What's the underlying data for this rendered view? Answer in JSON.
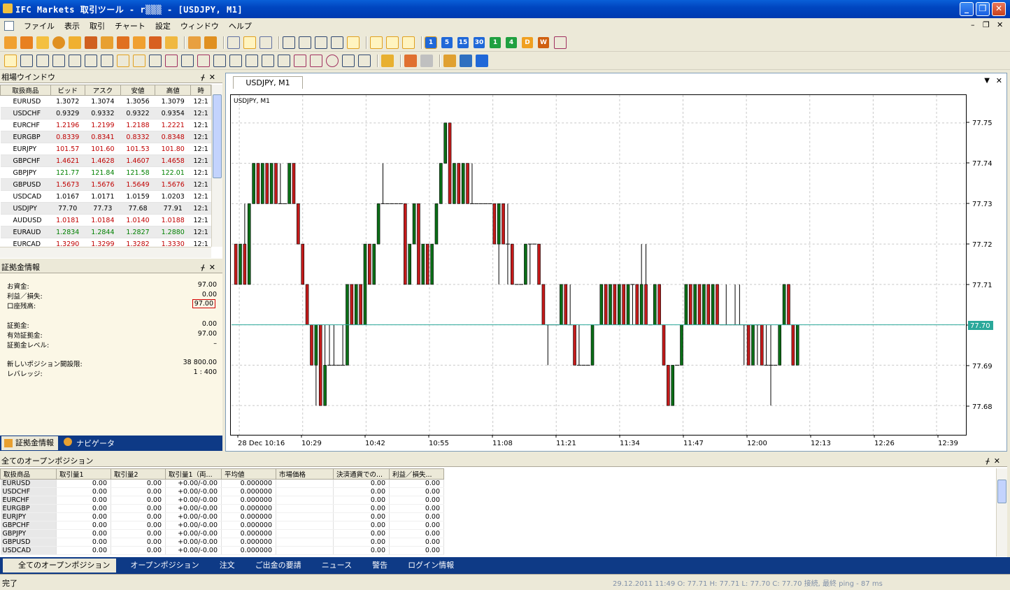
{
  "window": {
    "title": "IFC Markets 取引ツール - r▒▒▒ - [USDJPY, M1]"
  },
  "menu": [
    "ファイル",
    "表示",
    "取引",
    "チャート",
    "設定",
    "ウィンドウ",
    "ヘルプ"
  ],
  "timeframes": [
    "1",
    "5",
    "15",
    "30",
    "1",
    "4",
    "D",
    "W"
  ],
  "market_watch": {
    "title": "相場ウインドウ",
    "columns": [
      "取扱商品",
      "ビッド",
      "アスク",
      "安値",
      "高値",
      "時"
    ],
    "rows": [
      {
        "sym": "EURUSD",
        "bid": "1.3072",
        "ask": "1.3074",
        "low": "1.3056",
        "high": "1.3079",
        "time": "12:1",
        "dir": "n"
      },
      {
        "sym": "USDCHF",
        "bid": "0.9329",
        "ask": "0.9332",
        "low": "0.9322",
        "high": "0.9354",
        "time": "12:1",
        "dir": "n"
      },
      {
        "sym": "EURCHF",
        "bid": "1.2196",
        "ask": "1.2199",
        "low": "1.2188",
        "high": "1.2221",
        "time": "12:1",
        "dir": "dn"
      },
      {
        "sym": "EURGBP",
        "bid": "0.8339",
        "ask": "0.8341",
        "low": "0.8332",
        "high": "0.8348",
        "time": "12:1",
        "dir": "dn"
      },
      {
        "sym": "EURJPY",
        "bid": "101.57",
        "ask": "101.60",
        "low": "101.53",
        "high": "101.80",
        "time": "12:1",
        "dir": "dn"
      },
      {
        "sym": "GBPCHF",
        "bid": "1.4621",
        "ask": "1.4628",
        "low": "1.4607",
        "high": "1.4658",
        "time": "12:1",
        "dir": "dn"
      },
      {
        "sym": "GBPJPY",
        "bid": "121.77",
        "ask": "121.84",
        "low": "121.58",
        "high": "122.01",
        "time": "12:1",
        "dir": "up"
      },
      {
        "sym": "GBPUSD",
        "bid": "1.5673",
        "ask": "1.5676",
        "low": "1.5649",
        "high": "1.5676",
        "time": "12:1",
        "dir": "dn"
      },
      {
        "sym": "USDCAD",
        "bid": "1.0167",
        "ask": "1.0171",
        "low": "1.0159",
        "high": "1.0203",
        "time": "12:1",
        "dir": "n"
      },
      {
        "sym": "USDJPY",
        "bid": "77.70",
        "ask": "77.73",
        "low": "77.68",
        "high": "77.91",
        "time": "12:1",
        "dir": "n"
      },
      {
        "sym": "AUDUSD",
        "bid": "1.0181",
        "ask": "1.0184",
        "low": "1.0140",
        "high": "1.0188",
        "time": "12:1",
        "dir": "dn"
      },
      {
        "sym": "EURAUD",
        "bid": "1.2834",
        "ask": "1.2844",
        "low": "1.2827",
        "high": "1.2880",
        "time": "12:1",
        "dir": "up"
      },
      {
        "sym": "EURCAD",
        "bid": "1.3290",
        "ask": "1.3299",
        "low": "1.3282",
        "high": "1.3330",
        "time": "12:1",
        "dir": "dn"
      }
    ]
  },
  "account": {
    "title": "証拠金情報",
    "rows": [
      {
        "label": "お資金:",
        "value": "97.00"
      },
      {
        "label": "利益／損失:",
        "value": "0.00"
      },
      {
        "label": "口座残高:",
        "value": "97.00"
      },
      {
        "label": "証拠金:",
        "value": "0.00"
      },
      {
        "label": "有効証拠金:",
        "value": "97.00"
      },
      {
        "label": "証拠金レベル:",
        "value": "–"
      },
      {
        "label": "新しいポジション開設限:",
        "value": "38 800.00"
      },
      {
        "label": "レバレッジ:",
        "value": "1 : 400"
      }
    ],
    "tabs": [
      "証拠金情報",
      "ナビゲータ"
    ]
  },
  "chart": {
    "tab": "USDJPY, M1",
    "label": "USDJPY, M1",
    "current_price": "77.70"
  },
  "chart_data": {
    "type": "candlestick",
    "y_ticks": [
      "77.75",
      "77.74",
      "77.73",
      "77.72",
      "77.71",
      "77.70",
      "77.69",
      "77.68"
    ],
    "ylim": [
      77.675,
      77.755
    ],
    "x_ticks": [
      "28 Dec 10:16",
      "10:29",
      "10:42",
      "10:55",
      "11:08",
      "11:21",
      "11:34",
      "11:47",
      "12:00",
      "12:13",
      "12:26",
      "12:39"
    ],
    "ohlc": [
      [
        77.72,
        77.72,
        77.71,
        77.71
      ],
      [
        77.71,
        77.72,
        77.71,
        77.72
      ],
      [
        77.72,
        77.73,
        77.71,
        77.71
      ],
      [
        77.71,
        77.73,
        77.71,
        77.73
      ],
      [
        77.73,
        77.74,
        77.73,
        77.74
      ],
      [
        77.74,
        77.74,
        77.73,
        77.73
      ],
      [
        77.73,
        77.74,
        77.73,
        77.74
      ],
      [
        77.74,
        77.74,
        77.73,
        77.73
      ],
      [
        77.73,
        77.74,
        77.73,
        77.74
      ],
      [
        77.74,
        77.74,
        77.73,
        77.73
      ],
      [
        77.73,
        77.74,
        77.73,
        77.73
      ],
      [
        77.73,
        77.73,
        77.73,
        77.73
      ],
      [
        77.73,
        77.74,
        77.73,
        77.74
      ],
      [
        77.74,
        77.74,
        77.73,
        77.73
      ],
      [
        77.73,
        77.73,
        77.72,
        77.72
      ],
      [
        77.72,
        77.72,
        77.71,
        77.71
      ],
      [
        77.71,
        77.71,
        77.7,
        77.7
      ],
      [
        77.7,
        77.7,
        77.69,
        77.69
      ],
      [
        77.69,
        77.7,
        77.68,
        77.7
      ],
      [
        77.7,
        77.7,
        77.68,
        77.68
      ],
      [
        77.68,
        77.7,
        77.68,
        77.69
      ],
      [
        77.69,
        77.7,
        77.69,
        77.69
      ],
      [
        77.69,
        77.7,
        77.69,
        77.69
      ],
      [
        77.69,
        77.69,
        77.69,
        77.69
      ],
      [
        77.69,
        77.7,
        77.69,
        77.69
      ],
      [
        77.69,
        77.71,
        77.69,
        77.71
      ],
      [
        77.71,
        77.71,
        77.7,
        77.7
      ],
      [
        77.7,
        77.71,
        77.7,
        77.71
      ],
      [
        77.71,
        77.71,
        77.7,
        77.7
      ],
      [
        77.7,
        77.72,
        77.7,
        77.72
      ],
      [
        77.72,
        77.72,
        77.71,
        77.71
      ],
      [
        77.71,
        77.72,
        77.71,
        77.72
      ],
      [
        77.72,
        77.73,
        77.72,
        77.73
      ],
      [
        77.73,
        77.74,
        77.73,
        77.73
      ],
      [
        77.73,
        77.73,
        77.73,
        77.73
      ],
      [
        77.73,
        77.73,
        77.73,
        77.73
      ],
      [
        77.73,
        77.73,
        77.73,
        77.73
      ],
      [
        77.73,
        77.73,
        77.73,
        77.73
      ],
      [
        77.73,
        77.73,
        77.71,
        77.71
      ],
      [
        77.71,
        77.72,
        77.71,
        77.72
      ],
      [
        77.72,
        77.73,
        77.72,
        77.73
      ],
      [
        77.73,
        77.73,
        77.71,
        77.71
      ],
      [
        77.71,
        77.72,
        77.71,
        77.72
      ],
      [
        77.72,
        77.72,
        77.71,
        77.71
      ],
      [
        77.71,
        77.72,
        77.71,
        77.72
      ],
      [
        77.72,
        77.73,
        77.72,
        77.73
      ],
      [
        77.73,
        77.74,
        77.73,
        77.74
      ],
      [
        77.74,
        77.75,
        77.74,
        77.75
      ],
      [
        77.75,
        77.75,
        77.73,
        77.73
      ],
      [
        77.73,
        77.74,
        77.73,
        77.74
      ],
      [
        77.74,
        77.74,
        77.73,
        77.73
      ],
      [
        77.73,
        77.74,
        77.73,
        77.74
      ],
      [
        77.74,
        77.74,
        77.73,
        77.73
      ],
      [
        77.73,
        77.74,
        77.73,
        77.73
      ],
      [
        77.73,
        77.73,
        77.73,
        77.73
      ],
      [
        77.73,
        77.73,
        77.73,
        77.73
      ],
      [
        77.73,
        77.73,
        77.73,
        77.73
      ],
      [
        77.73,
        77.73,
        77.73,
        77.73
      ],
      [
        77.73,
        77.73,
        77.72,
        77.72
      ],
      [
        77.72,
        77.73,
        77.71,
        77.73
      ],
      [
        77.73,
        77.73,
        77.72,
        77.72
      ],
      [
        77.72,
        77.73,
        77.71,
        77.72
      ],
      [
        77.72,
        77.72,
        77.71,
        77.71
      ],
      [
        77.71,
        77.71,
        77.71,
        77.71
      ],
      [
        77.71,
        77.71,
        77.71,
        77.71
      ],
      [
        77.71,
        77.72,
        77.71,
        77.72
      ],
      [
        77.72,
        77.72,
        77.71,
        77.72
      ],
      [
        77.72,
        77.72,
        77.72,
        77.72
      ],
      [
        77.72,
        77.72,
        77.71,
        77.71
      ],
      [
        77.71,
        77.71,
        77.7,
        77.7
      ],
      [
        77.7,
        77.7,
        77.69,
        77.7
      ],
      [
        77.7,
        77.7,
        77.7,
        77.7
      ],
      [
        77.7,
        77.7,
        77.7,
        77.7
      ],
      [
        77.7,
        77.71,
        77.7,
        77.71
      ],
      [
        77.71,
        77.71,
        77.7,
        77.7
      ],
      [
        77.7,
        77.71,
        77.7,
        77.7
      ],
      [
        77.7,
        77.7,
        77.69,
        77.69
      ],
      [
        77.69,
        77.7,
        77.69,
        77.69
      ],
      [
        77.69,
        77.69,
        77.69,
        77.69
      ],
      [
        77.69,
        77.69,
        77.69,
        77.69
      ],
      [
        77.69,
        77.7,
        77.69,
        77.7
      ],
      [
        77.7,
        77.7,
        77.7,
        77.7
      ],
      [
        77.7,
        77.71,
        77.7,
        77.71
      ],
      [
        77.71,
        77.71,
        77.7,
        77.7
      ],
      [
        77.7,
        77.71,
        77.7,
        77.71
      ],
      [
        77.71,
        77.71,
        77.7,
        77.7
      ],
      [
        77.7,
        77.71,
        77.7,
        77.71
      ],
      [
        77.71,
        77.71,
        77.7,
        77.7
      ],
      [
        77.7,
        77.71,
        77.7,
        77.71
      ],
      [
        77.71,
        77.71,
        77.7,
        77.71
      ],
      [
        77.71,
        77.71,
        77.7,
        77.7
      ],
      [
        77.7,
        77.72,
        77.7,
        77.71
      ],
      [
        77.71,
        77.72,
        77.7,
        77.7
      ],
      [
        77.7,
        77.7,
        77.7,
        77.7
      ],
      [
        77.7,
        77.71,
        77.7,
        77.71
      ],
      [
        77.71,
        77.71,
        77.7,
        77.7
      ],
      [
        77.7,
        77.7,
        77.69,
        77.69
      ],
      [
        77.69,
        77.69,
        77.68,
        77.68
      ],
      [
        77.68,
        77.69,
        77.68,
        77.69
      ],
      [
        77.69,
        77.69,
        77.69,
        77.69
      ],
      [
        77.69,
        77.7,
        77.69,
        77.7
      ],
      [
        77.7,
        77.71,
        77.7,
        77.71
      ],
      [
        77.71,
        77.71,
        77.7,
        77.7
      ],
      [
        77.7,
        77.71,
        77.7,
        77.71
      ],
      [
        77.71,
        77.71,
        77.7,
        77.7
      ],
      [
        77.7,
        77.71,
        77.7,
        77.71
      ],
      [
        77.71,
        77.71,
        77.7,
        77.7
      ],
      [
        77.7,
        77.71,
        77.7,
        77.71
      ],
      [
        77.71,
        77.71,
        77.7,
        77.7
      ],
      [
        77.7,
        77.7,
        77.7,
        77.7
      ],
      [
        77.7,
        77.71,
        77.7,
        77.7
      ],
      [
        77.7,
        77.7,
        77.7,
        77.7
      ],
      [
        77.7,
        77.71,
        77.7,
        77.7
      ],
      [
        77.7,
        77.71,
        77.7,
        77.7
      ],
      [
        77.7,
        77.7,
        77.69,
        77.7
      ],
      [
        77.7,
        77.7,
        77.69,
        77.69
      ],
      [
        77.69,
        77.7,
        77.69,
        77.7
      ],
      [
        77.7,
        77.7,
        77.69,
        77.7
      ],
      [
        77.7,
        77.7,
        77.69,
        77.69
      ],
      [
        77.69,
        77.7,
        77.69,
        77.69
      ],
      [
        77.69,
        77.7,
        77.68,
        77.69
      ],
      [
        77.69,
        77.69,
        77.69,
        77.69
      ],
      [
        77.69,
        77.7,
        77.69,
        77.7
      ],
      [
        77.7,
        77.71,
        77.7,
        77.71
      ],
      [
        77.71,
        77.71,
        77.7,
        77.7
      ],
      [
        77.7,
        77.7,
        77.69,
        77.69
      ],
      [
        77.69,
        77.7,
        77.69,
        77.7
      ]
    ]
  },
  "positions": {
    "title": "全てのオープンポジション",
    "columns": [
      "取扱商品",
      "取引量1",
      "取引量2",
      "取引量1（両...",
      "平均値",
      "市場価格",
      "決済通貨での...",
      "利益／損失..."
    ],
    "rows": [
      [
        "EURUSD",
        "0.00",
        "0.00",
        "+0.00/-0.00",
        "0.000000",
        "",
        "0.00",
        "0.00"
      ],
      [
        "USDCHF",
        "0.00",
        "0.00",
        "+0.00/-0.00",
        "0.000000",
        "",
        "0.00",
        "0.00"
      ],
      [
        "EURCHF",
        "0.00",
        "0.00",
        "+0.00/-0.00",
        "0.000000",
        "",
        "0.00",
        "0.00"
      ],
      [
        "EURGBP",
        "0.00",
        "0.00",
        "+0.00/-0.00",
        "0.000000",
        "",
        "0.00",
        "0.00"
      ],
      [
        "EURJPY",
        "0.00",
        "0.00",
        "+0.00/-0.00",
        "0.000000",
        "",
        "0.00",
        "0.00"
      ],
      [
        "GBPCHF",
        "0.00",
        "0.00",
        "+0.00/-0.00",
        "0.000000",
        "",
        "0.00",
        "0.00"
      ],
      [
        "GBPJPY",
        "0.00",
        "0.00",
        "+0.00/-0.00",
        "0.000000",
        "",
        "0.00",
        "0.00"
      ],
      [
        "GBPUSD",
        "0.00",
        "0.00",
        "+0.00/-0.00",
        "0.000000",
        "",
        "0.00",
        "0.00"
      ],
      [
        "USDCAD",
        "0.00",
        "0.00",
        "+0.00/-0.00",
        "0.000000",
        "",
        "0.00",
        "0.00"
      ]
    ]
  },
  "bottom_tabs": [
    "全てのオープンポジション",
    "オープンポジション",
    "注文",
    "ご出金の要請",
    "ニュース",
    "警告",
    "ログイン情報"
  ],
  "status": {
    "left": "完了",
    "right": "29.12.2011 11:49  O: 77.71   H: 77.71   L: 77.70   C: 77.70    接続, 最終 ping - 87 ms"
  }
}
